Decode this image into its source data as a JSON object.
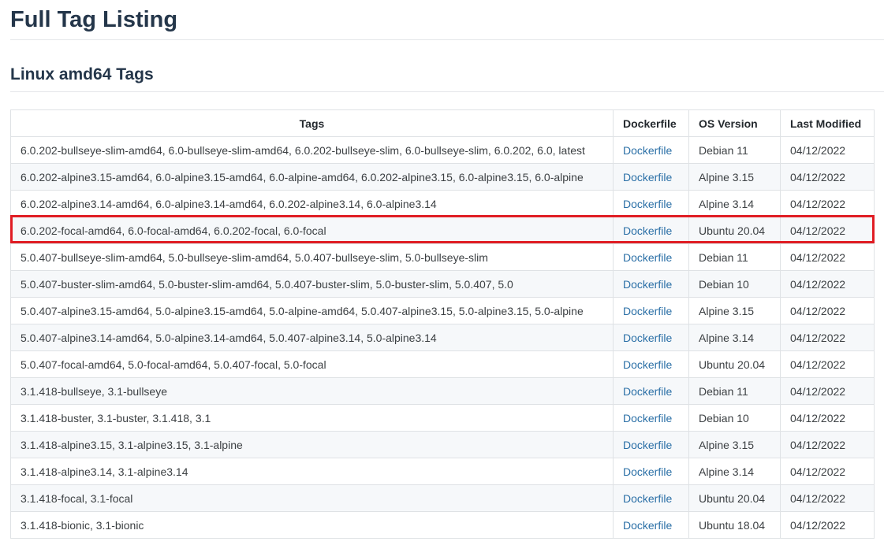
{
  "page": {
    "title": "Full Tag Listing",
    "section_title": "Linux amd64 Tags"
  },
  "table": {
    "headers": [
      "Tags",
      "Dockerfile",
      "OS Version",
      "Last Modified"
    ],
    "highlighted_row": 3,
    "rows": [
      {
        "tags": "6.0.202-bullseye-slim-amd64, 6.0-bullseye-slim-amd64, 6.0.202-bullseye-slim, 6.0-bullseye-slim, 6.0.202, 6.0, latest",
        "dockerfile": "Dockerfile",
        "os": "Debian 11",
        "modified": "04/12/2022"
      },
      {
        "tags": "6.0.202-alpine3.15-amd64, 6.0-alpine3.15-amd64, 6.0-alpine-amd64, 6.0.202-alpine3.15, 6.0-alpine3.15, 6.0-alpine",
        "dockerfile": "Dockerfile",
        "os": "Alpine 3.15",
        "modified": "04/12/2022"
      },
      {
        "tags": "6.0.202-alpine3.14-amd64, 6.0-alpine3.14-amd64, 6.0.202-alpine3.14, 6.0-alpine3.14",
        "dockerfile": "Dockerfile",
        "os": "Alpine 3.14",
        "modified": "04/12/2022"
      },
      {
        "tags": "6.0.202-focal-amd64, 6.0-focal-amd64, 6.0.202-focal, 6.0-focal",
        "dockerfile": "Dockerfile",
        "os": "Ubuntu 20.04",
        "modified": "04/12/2022"
      },
      {
        "tags": "5.0.407-bullseye-slim-amd64, 5.0-bullseye-slim-amd64, 5.0.407-bullseye-slim, 5.0-bullseye-slim",
        "dockerfile": "Dockerfile",
        "os": "Debian 11",
        "modified": "04/12/2022"
      },
      {
        "tags": "5.0.407-buster-slim-amd64, 5.0-buster-slim-amd64, 5.0.407-buster-slim, 5.0-buster-slim, 5.0.407, 5.0",
        "dockerfile": "Dockerfile",
        "os": "Debian 10",
        "modified": "04/12/2022"
      },
      {
        "tags": "5.0.407-alpine3.15-amd64, 5.0-alpine3.15-amd64, 5.0-alpine-amd64, 5.0.407-alpine3.15, 5.0-alpine3.15, 5.0-alpine",
        "dockerfile": "Dockerfile",
        "os": "Alpine 3.15",
        "modified": "04/12/2022"
      },
      {
        "tags": "5.0.407-alpine3.14-amd64, 5.0-alpine3.14-amd64, 5.0.407-alpine3.14, 5.0-alpine3.14",
        "dockerfile": "Dockerfile",
        "os": "Alpine 3.14",
        "modified": "04/12/2022"
      },
      {
        "tags": "5.0.407-focal-amd64, 5.0-focal-amd64, 5.0.407-focal, 5.0-focal",
        "dockerfile": "Dockerfile",
        "os": "Ubuntu 20.04",
        "modified": "04/12/2022"
      },
      {
        "tags": "3.1.418-bullseye, 3.1-bullseye",
        "dockerfile": "Dockerfile",
        "os": "Debian 11",
        "modified": "04/12/2022"
      },
      {
        "tags": "3.1.418-buster, 3.1-buster, 3.1.418, 3.1",
        "dockerfile": "Dockerfile",
        "os": "Debian 10",
        "modified": "04/12/2022"
      },
      {
        "tags": "3.1.418-alpine3.15, 3.1-alpine3.15, 3.1-alpine",
        "dockerfile": "Dockerfile",
        "os": "Alpine 3.15",
        "modified": "04/12/2022"
      },
      {
        "tags": "3.1.418-alpine3.14, 3.1-alpine3.14",
        "dockerfile": "Dockerfile",
        "os": "Alpine 3.14",
        "modified": "04/12/2022"
      },
      {
        "tags": "3.1.418-focal, 3.1-focal",
        "dockerfile": "Dockerfile",
        "os": "Ubuntu 20.04",
        "modified": "04/12/2022"
      },
      {
        "tags": "3.1.418-bionic, 3.1-bionic",
        "dockerfile": "Dockerfile",
        "os": "Ubuntu 18.04",
        "modified": "04/12/2022"
      }
    ]
  },
  "colors": {
    "heading": "#24364a",
    "link": "#2a6fa6",
    "highlight_border": "#e01d24",
    "row_stripe": "#f6f8fa",
    "border": "#dfe2e5"
  }
}
